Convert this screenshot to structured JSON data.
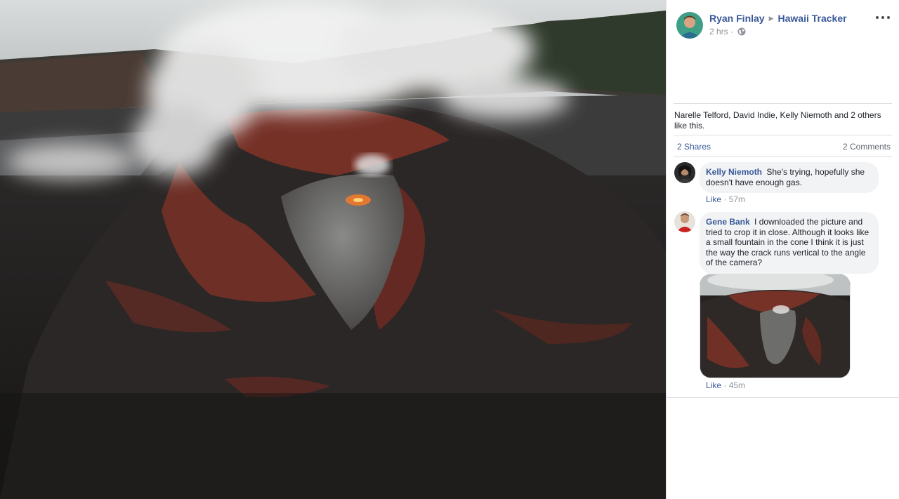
{
  "post": {
    "author": "Ryan Finlay",
    "group": "Hawaii Tracker",
    "time": "2 hrs",
    "audience_icon": "globe-icon",
    "more_icon": "more-options-icon"
  },
  "reactions": {
    "likes_text": "Narelle Telford, David Indie, Kelly Niemoth and 2 others like this.",
    "shares": "2 Shares",
    "comments": "2 Comments"
  },
  "comments": [
    {
      "name": "Kelly Niemoth",
      "text": "She's trying, hopefully she doesn't have enough gas.",
      "like_label": "Like",
      "time": "57m"
    },
    {
      "name": "Gene Bank",
      "text": "I downloaded the picture and tried to crop it in close. Although it looks like a small fountain in the cone I think it is just the way the crack runs vertical to the angle of the camera?",
      "like_label": "Like",
      "time": "45m"
    }
  ],
  "colors": {
    "link": "#385898",
    "meta": "#90949c",
    "bubble": "#f2f3f5",
    "lava_red": "#b5402e"
  }
}
